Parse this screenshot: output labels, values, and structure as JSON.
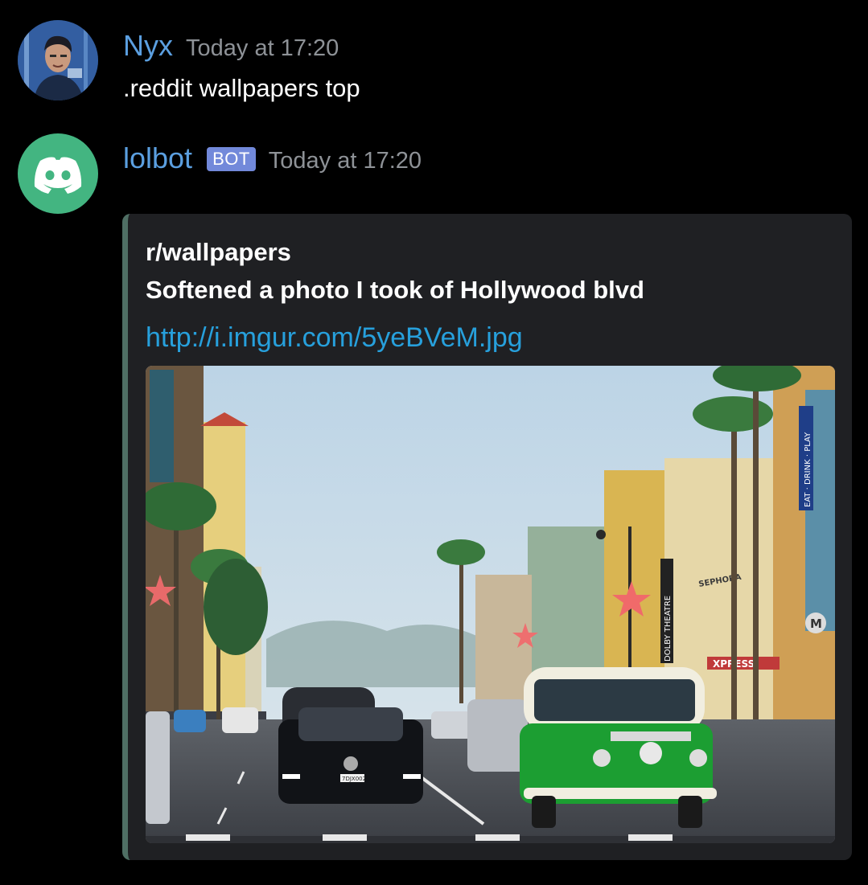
{
  "messages": [
    {
      "username": "Nyx",
      "timestamp": "Today at 17:20",
      "content": ".reddit wallpapers top",
      "username_color": "#5b9fe0"
    },
    {
      "username": "lolbot",
      "bot_tag": "BOT",
      "timestamp": "Today at 17:20",
      "avatar_icon": "discord-logo-icon",
      "avatar_color": "#43b581",
      "embed": {
        "author": "r/wallpapers",
        "title": "Softened a photo I took of Hollywood blvd",
        "link": "http://i.imgur.com/5yeBVeM.jpg",
        "accent_color": "#4f6f64",
        "image_signs": {
          "theatre": "DOLBY THEATRE",
          "store": "SEPHORA",
          "arcade": "EAT · DRINK · PLAY",
          "metro": "M",
          "express": "XPRESS",
          "plate": "7DJX002"
        }
      }
    }
  ]
}
